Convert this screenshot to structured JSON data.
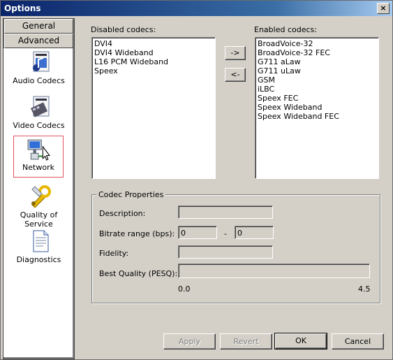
{
  "window": {
    "title": "Options",
    "close_glyph": "×"
  },
  "sidebar": {
    "tabs": [
      {
        "label": "General"
      },
      {
        "label": "Advanced"
      }
    ],
    "items": [
      {
        "label": "Audio Codecs",
        "icon": "audio-codecs-icon"
      },
      {
        "label": "Video Codecs",
        "icon": "video-codecs-icon"
      },
      {
        "label": "Network",
        "icon": "network-icon",
        "selected": true
      },
      {
        "label": "Quality of Service",
        "icon": "quality-of-service-icon"
      },
      {
        "label": "Diagnostics",
        "icon": "diagnostics-icon"
      }
    ]
  },
  "codecs": {
    "disabled_label": "Disabled codecs:",
    "enabled_label": "Enabled codecs:",
    "disabled": [
      "DVI4",
      "DVI4 Wideband",
      "L16 PCM Wideband",
      "Speex"
    ],
    "enabled": [
      "BroadVoice-32",
      "BroadVoice-32 FEC",
      "G711 aLaw",
      "G711 uLaw",
      "GSM",
      "iLBC",
      "Speex FEC",
      "Speex Wideband",
      "Speex Wideband FEC"
    ],
    "move_right": "->",
    "move_left": "<-"
  },
  "properties": {
    "group_label": "Codec Properties",
    "description_label": "Description:",
    "description_value": "",
    "bitrate_label": "Bitrate range (bps):",
    "bitrate_min": "0",
    "bitrate_sep": "-",
    "bitrate_max": "0",
    "fidelity_label": "Fidelity:",
    "fidelity_value": "",
    "best_quality_label": "Best Quality (PESQ):",
    "scale_min": "0.0",
    "scale_max": "4.5"
  },
  "footer": {
    "apply": "Apply",
    "revert": "Revert",
    "ok": "OK",
    "cancel": "Cancel"
  }
}
